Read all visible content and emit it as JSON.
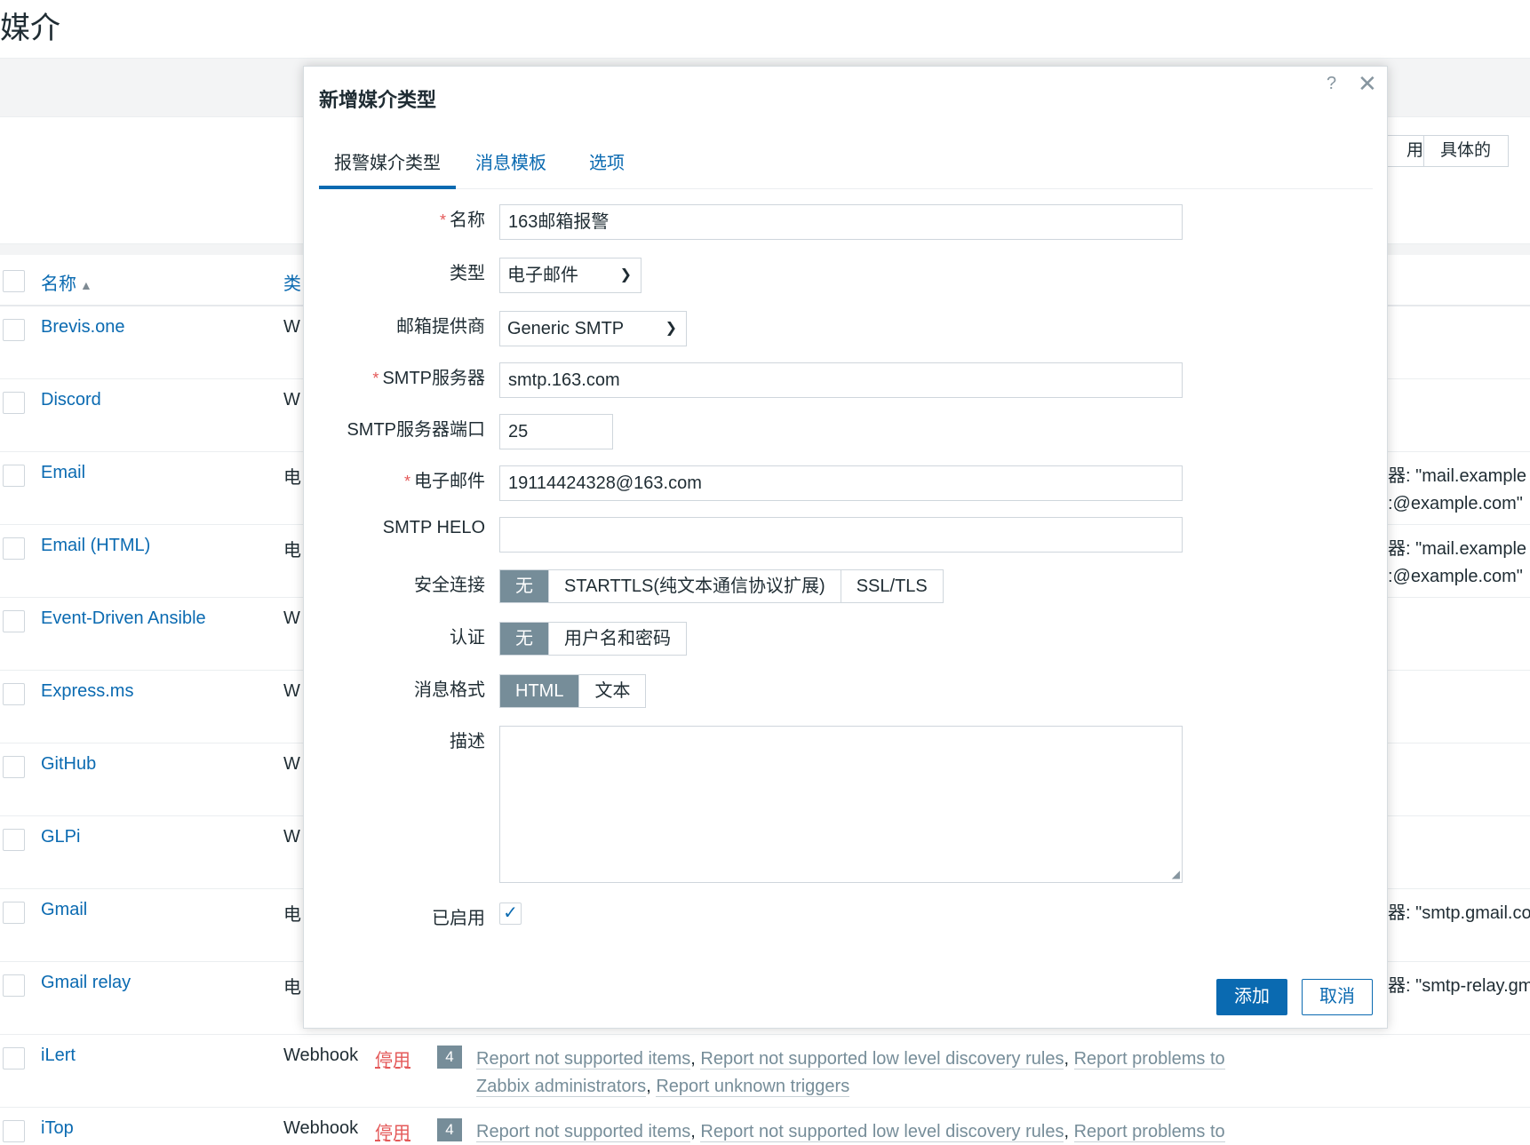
{
  "page": {
    "title": "媒介",
    "filter_segment": [
      "用",
      "具体的"
    ]
  },
  "table": {
    "headers": {
      "name": "名称",
      "sort_indicator": "▲",
      "type": "类"
    },
    "rows": [
      {
        "name": "Brevis.one",
        "type": "W"
      },
      {
        "name": "Discord",
        "type": "W"
      },
      {
        "name": "Email",
        "type": "电",
        "details": [
          "器: \"mail.example",
          ":@example.com\""
        ]
      },
      {
        "name": "Email (HTML)",
        "type": "电",
        "details": [
          "器: \"mail.example",
          ":@example.com\""
        ]
      },
      {
        "name": "Event-Driven Ansible",
        "type": "W"
      },
      {
        "name": "Express.ms",
        "type": "W"
      },
      {
        "name": "GitHub",
        "type": "W"
      },
      {
        "name": "GLPi",
        "type": "W"
      },
      {
        "name": "Gmail",
        "type": "电",
        "details": [
          "器: \"smtp.gmail.co"
        ]
      },
      {
        "name": "Gmail relay",
        "type": "电",
        "details": [
          "器: \"smtp-relay.gm"
        ]
      },
      {
        "name": "iLert",
        "type": "Webhook",
        "status": "停用",
        "count": "4",
        "actions": [
          "Report not supported items",
          "Report not supported low level discovery rules",
          "Report problems to Zabbix administrators",
          "Report unknown triggers"
        ]
      },
      {
        "name": "iTop",
        "type": "Webhook",
        "status": "停用",
        "count": "4",
        "actions": [
          "Report not supported items",
          "Report not supported low level discovery rules",
          "Report problems to"
        ]
      }
    ]
  },
  "modal": {
    "title": "新增媒介类型",
    "help": "?",
    "close": "✕",
    "tabs": [
      "报警媒介类型",
      "消息模板",
      "选项"
    ],
    "form": {
      "name_label": "名称",
      "name_value": "163邮箱报警",
      "type_label": "类型",
      "type_value": "电子邮件",
      "provider_label": "邮箱提供商",
      "provider_value": "Generic SMTP",
      "smtp_server_label": "SMTP服务器",
      "smtp_server_value": "smtp.163.com",
      "smtp_port_label": "SMTP服务器端口",
      "smtp_port_value": "25",
      "email_label": "电子邮件",
      "email_value": "19114424328@163.com",
      "helo_label": "SMTP HELO",
      "helo_value": "",
      "security_label": "安全连接",
      "security_options": [
        "无",
        "STARTTLS(纯文本通信协议扩展)",
        "SSL/TLS"
      ],
      "auth_label": "认证",
      "auth_options": [
        "无",
        "用户名和密码"
      ],
      "format_label": "消息格式",
      "format_options": [
        "HTML",
        "文本"
      ],
      "description_label": "描述",
      "enabled_label": "已启用",
      "enabled_mark": "✓"
    },
    "buttons": {
      "add": "添加",
      "cancel": "取消"
    }
  },
  "colors": {
    "accent": "#0a6ab1",
    "segment_active": "#768d99",
    "disabled": "#e45959"
  }
}
